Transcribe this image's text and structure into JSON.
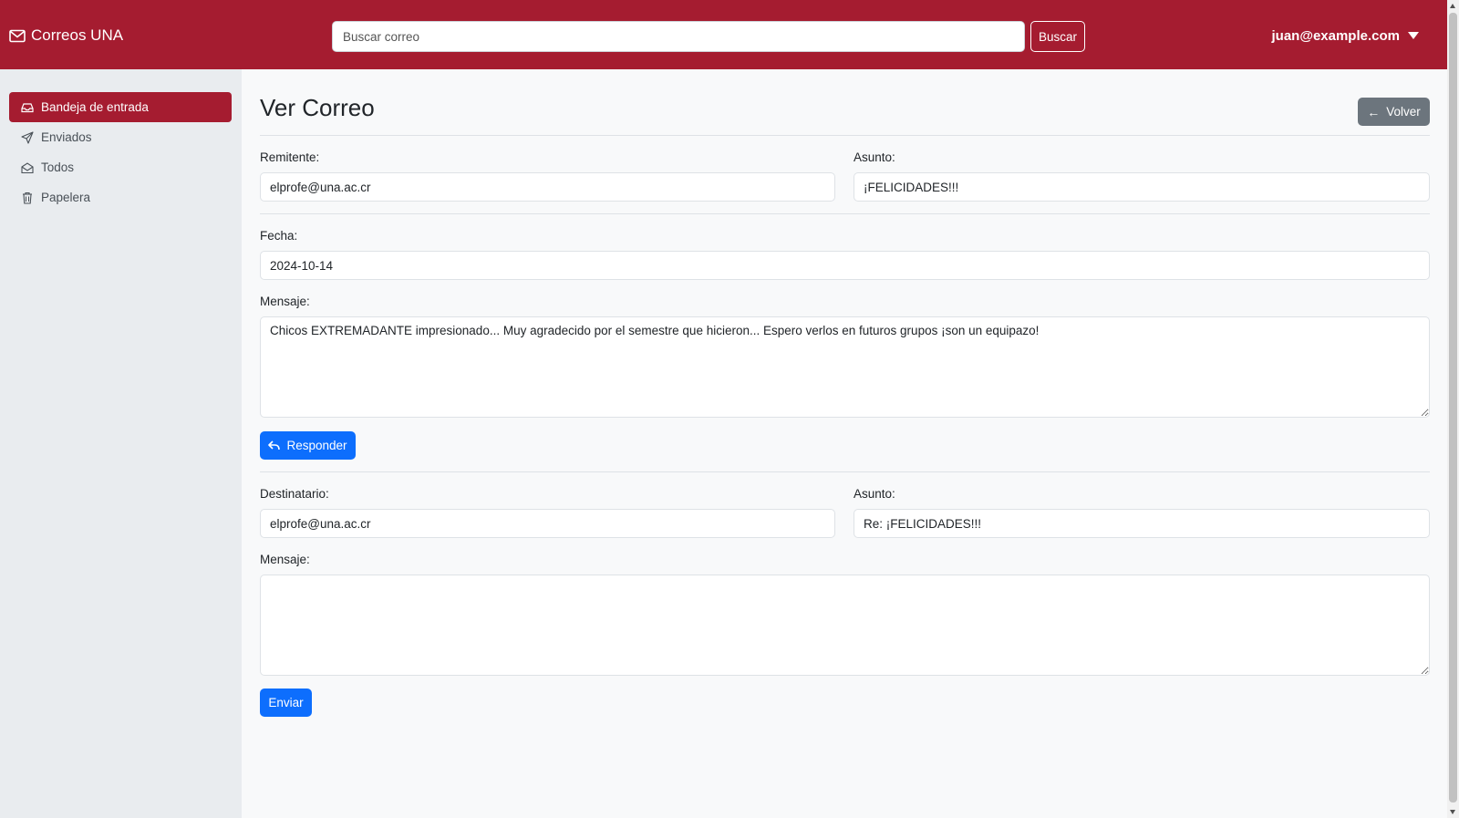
{
  "header": {
    "brand": "Correos UNA",
    "brand_icon": "envelope-icon",
    "search_placeholder": "Buscar correo",
    "search_button": "Buscar",
    "user_email": "juan@example.com"
  },
  "sidebar": {
    "items": [
      {
        "label": "Bandeja de entrada",
        "icon": "inbox-icon",
        "active": true
      },
      {
        "label": "Enviados",
        "icon": "send-icon",
        "active": false
      },
      {
        "label": "Todos",
        "icon": "envelope-open-icon",
        "active": false
      },
      {
        "label": "Papelera",
        "icon": "trash-icon",
        "active": false
      }
    ]
  },
  "main": {
    "title": "Ver Correo",
    "back_button": "Volver",
    "email": {
      "sender_label": "Remitente:",
      "sender": "elprofe@una.ac.cr",
      "subject_label": "Asunto:",
      "subject": "¡FELICIDADES!!!",
      "date_label": "Fecha:",
      "date": "2024-10-14",
      "message_label": "Mensaje:",
      "message": "Chicos EXTREMADANTE impresionado... Muy agradecido por el semestre que hicieron... Espero verlos en futuros grupos ¡son un equipazo!"
    },
    "reply_button": "Responder",
    "reply": {
      "recipient_label": "Destinatario:",
      "recipient": "elprofe@una.ac.cr",
      "subject_label": "Asunto:",
      "subject": "Re: ¡FELICIDADES!!!",
      "message_label": "Mensaje:",
      "message": ""
    },
    "send_button": "Enviar"
  },
  "colors": {
    "brand": "#a51c30",
    "primary": "#0d6efd",
    "secondary": "#6c757d"
  }
}
